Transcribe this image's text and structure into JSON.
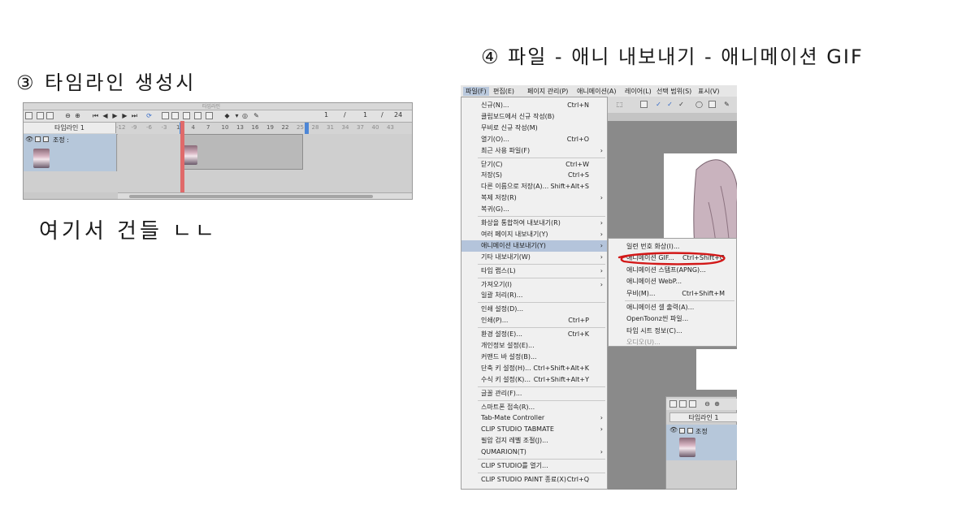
{
  "notes": {
    "step3_heading": "③ 타임라인 생성시",
    "step3_caption": "여기서 건들 ㄴㄴ",
    "step4_heading": "④ 파일 - 애니 내보내기 - 애니메이션 GIF"
  },
  "timeline_panel": {
    "title": "타임라인",
    "frame_current": "1",
    "frame_sep1": "/",
    "frame_start": "1",
    "frame_sep2": "/",
    "frame_total": "24",
    "timeline_select": "타임라인 1",
    "ruler_ticks": [
      "-12",
      "-9",
      "-6",
      "-3",
      "1",
      "4",
      "7",
      "10",
      "13",
      "16",
      "19",
      "22",
      "25",
      "28",
      "31",
      "34",
      "37",
      "40",
      "43"
    ],
    "layer_name": "조정 :"
  },
  "menubar": {
    "items": [
      "파일(F)",
      "편집(E)",
      "페이지 관리(P)",
      "애니메이션(A)",
      "레이어(L)",
      "선택 범위(S)",
      "표시(V)"
    ]
  },
  "file_menu": {
    "items": [
      {
        "label": "신규(N)...",
        "shortcut": "Ctrl+N",
        "arrow": ""
      },
      {
        "label": "클립보드에서 신규 작성(B)",
        "shortcut": "",
        "arrow": ""
      },
      {
        "label": "무비로 신규 작성(M)",
        "shortcut": "",
        "arrow": ""
      },
      {
        "label": "열기(O)...",
        "shortcut": "Ctrl+O",
        "arrow": ""
      },
      {
        "label": "최근 사용 파일(F)",
        "shortcut": "",
        "arrow": "›"
      },
      {
        "label": "닫기(C)",
        "shortcut": "Ctrl+W",
        "arrow": ""
      },
      {
        "label": "저장(S)",
        "shortcut": "Ctrl+S",
        "arrow": ""
      },
      {
        "label": "다른 이름으로 저장(A)...",
        "shortcut": "Shift+Alt+S",
        "arrow": ""
      },
      {
        "label": "복제 저장(R)",
        "shortcut": "",
        "arrow": "›"
      },
      {
        "label": "복귀(G)...",
        "shortcut": "",
        "arrow": ""
      },
      {
        "label": "화상을 통합하여 내보내기(R)",
        "shortcut": "",
        "arrow": "›"
      },
      {
        "label": "여러 페이지 내보내기(Y)",
        "shortcut": "",
        "arrow": "›"
      },
      {
        "label": "애니메이션 내보내기(Y)",
        "shortcut": "",
        "arrow": "›"
      },
      {
        "label": "기타 내보내기(W)",
        "shortcut": "",
        "arrow": "›"
      },
      {
        "label": "타임 랩스(L)",
        "shortcut": "",
        "arrow": "›"
      },
      {
        "label": "가져오기(I)",
        "shortcut": "",
        "arrow": "›"
      },
      {
        "label": "일괄 처리(R)...",
        "shortcut": "",
        "arrow": ""
      },
      {
        "label": "인쇄 설정(D)...",
        "shortcut": "",
        "arrow": ""
      },
      {
        "label": "인쇄(P)...",
        "shortcut": "Ctrl+P",
        "arrow": ""
      },
      {
        "label": "환경 설정(E)...",
        "shortcut": "Ctrl+K",
        "arrow": ""
      },
      {
        "label": "개인정보 설정(E)...",
        "shortcut": "",
        "arrow": ""
      },
      {
        "label": "커맨드 바 설정(B)...",
        "shortcut": "",
        "arrow": ""
      },
      {
        "label": "단축 키 설정(H)...",
        "shortcut": "Ctrl+Shift+Alt+K",
        "arrow": ""
      },
      {
        "label": "수식 키 설정(K)...",
        "shortcut": "Ctrl+Shift+Alt+Y",
        "arrow": ""
      },
      {
        "label": "글꼴 관리(F)...",
        "shortcut": "",
        "arrow": ""
      },
      {
        "label": "스마트폰 접속(R)...",
        "shortcut": "",
        "arrow": ""
      },
      {
        "label": "Tab-Mate Controller",
        "shortcut": "",
        "arrow": "›"
      },
      {
        "label": "CLIP STUDIO TABMATE",
        "shortcut": "",
        "arrow": "›"
      },
      {
        "label": "필압 검지 레벨 조절(J)...",
        "shortcut": "",
        "arrow": ""
      },
      {
        "label": "QUMARION(T)",
        "shortcut": "",
        "arrow": "›"
      },
      {
        "label": "CLIP STUDIO를 열기...",
        "shortcut": "",
        "arrow": ""
      },
      {
        "label": "CLIP STUDIO PAINT 종료(X)",
        "shortcut": "Ctrl+Q",
        "arrow": ""
      }
    ]
  },
  "export_submenu": {
    "items": [
      {
        "label": "일련 번호 화상(I)...",
        "shortcut": ""
      },
      {
        "label": "애니메이션 GIF...",
        "shortcut": "Ctrl+Shift+G"
      },
      {
        "label": "애니메이션 스탬프(APNG)...",
        "shortcut": ""
      },
      {
        "label": "애니메이션 WebP...",
        "shortcut": ""
      },
      {
        "label": "무비(M)...",
        "shortcut": "Ctrl+Shift+M"
      },
      {
        "label": "애니메이션 셀 출력(A)...",
        "shortcut": ""
      },
      {
        "label": "OpenToonz씬 파일...",
        "shortcut": ""
      },
      {
        "label": "타임 시트 정보(C)...",
        "shortcut": ""
      },
      {
        "label": "오디오(U)...",
        "shortcut": ""
      }
    ]
  },
  "mini_timeline": {
    "timeline_select": "타임라인 1",
    "layer_name": "조정"
  },
  "colors": {
    "highlight": "#b4c4db",
    "annotation_red": "#d21818",
    "playhead": "#e06a6a",
    "range_marker": "#4d86d6"
  }
}
